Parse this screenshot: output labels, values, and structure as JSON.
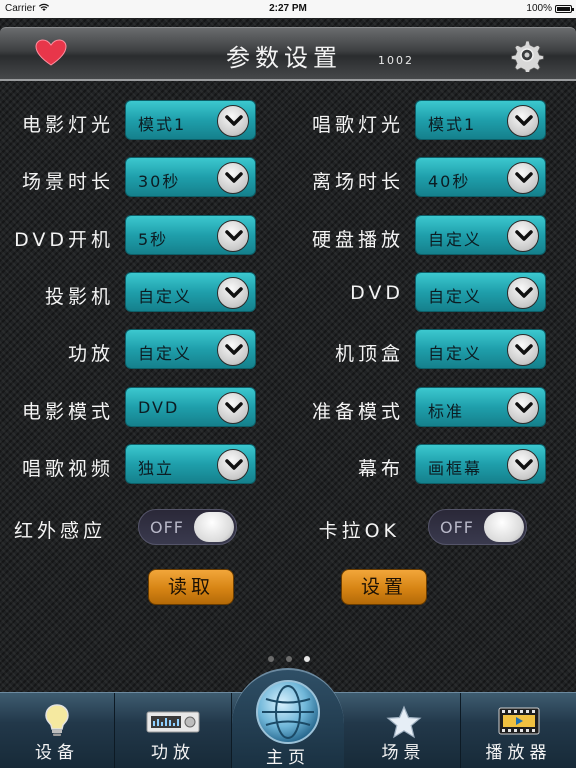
{
  "status_bar": {
    "carrier": "Carrier",
    "time": "2:27 PM",
    "battery": "100%"
  },
  "header": {
    "title": "参数设置",
    "code": "1002"
  },
  "left_rows": [
    {
      "label": "电影灯光",
      "value": "模式1"
    },
    {
      "label": "场景时长",
      "value": "30秒"
    },
    {
      "label": "DVD开机",
      "value": "5秒"
    },
    {
      "label": "投影机",
      "value": "自定义"
    },
    {
      "label": "功放",
      "value": "自定义"
    },
    {
      "label": "电影模式",
      "value": "DVD"
    },
    {
      "label": "唱歌视频",
      "value": "独立"
    }
  ],
  "right_rows": [
    {
      "label": "唱歌灯光",
      "value": "模式1"
    },
    {
      "label": "离场时长",
      "value": "40秒"
    },
    {
      "label": "硬盘播放",
      "value": "自定义"
    },
    {
      "label": "DVD",
      "value": "自定义"
    },
    {
      "label": "机顶盒",
      "value": "自定义"
    },
    {
      "label": "准备模式",
      "value": "标准"
    },
    {
      "label": "幕布",
      "value": "画框幕"
    }
  ],
  "toggles": [
    {
      "label": "红外感应",
      "state": "OFF"
    },
    {
      "label": "卡拉OK",
      "state": "OFF"
    }
  ],
  "actions": {
    "read": "读取",
    "set": "设置"
  },
  "pager": {
    "pages": 3,
    "active": 3
  },
  "tabs": [
    {
      "label": "设备",
      "icon": "lightbulb-icon"
    },
    {
      "label": "功放",
      "icon": "amplifier-icon"
    },
    {
      "label": "主页",
      "icon": "globe-icon"
    },
    {
      "label": "场景",
      "icon": "star-icon"
    },
    {
      "label": "播放器",
      "icon": "film-icon"
    }
  ],
  "colors": {
    "select": "#1f9fab",
    "button": "#d68414",
    "heart": "#e8364a"
  }
}
